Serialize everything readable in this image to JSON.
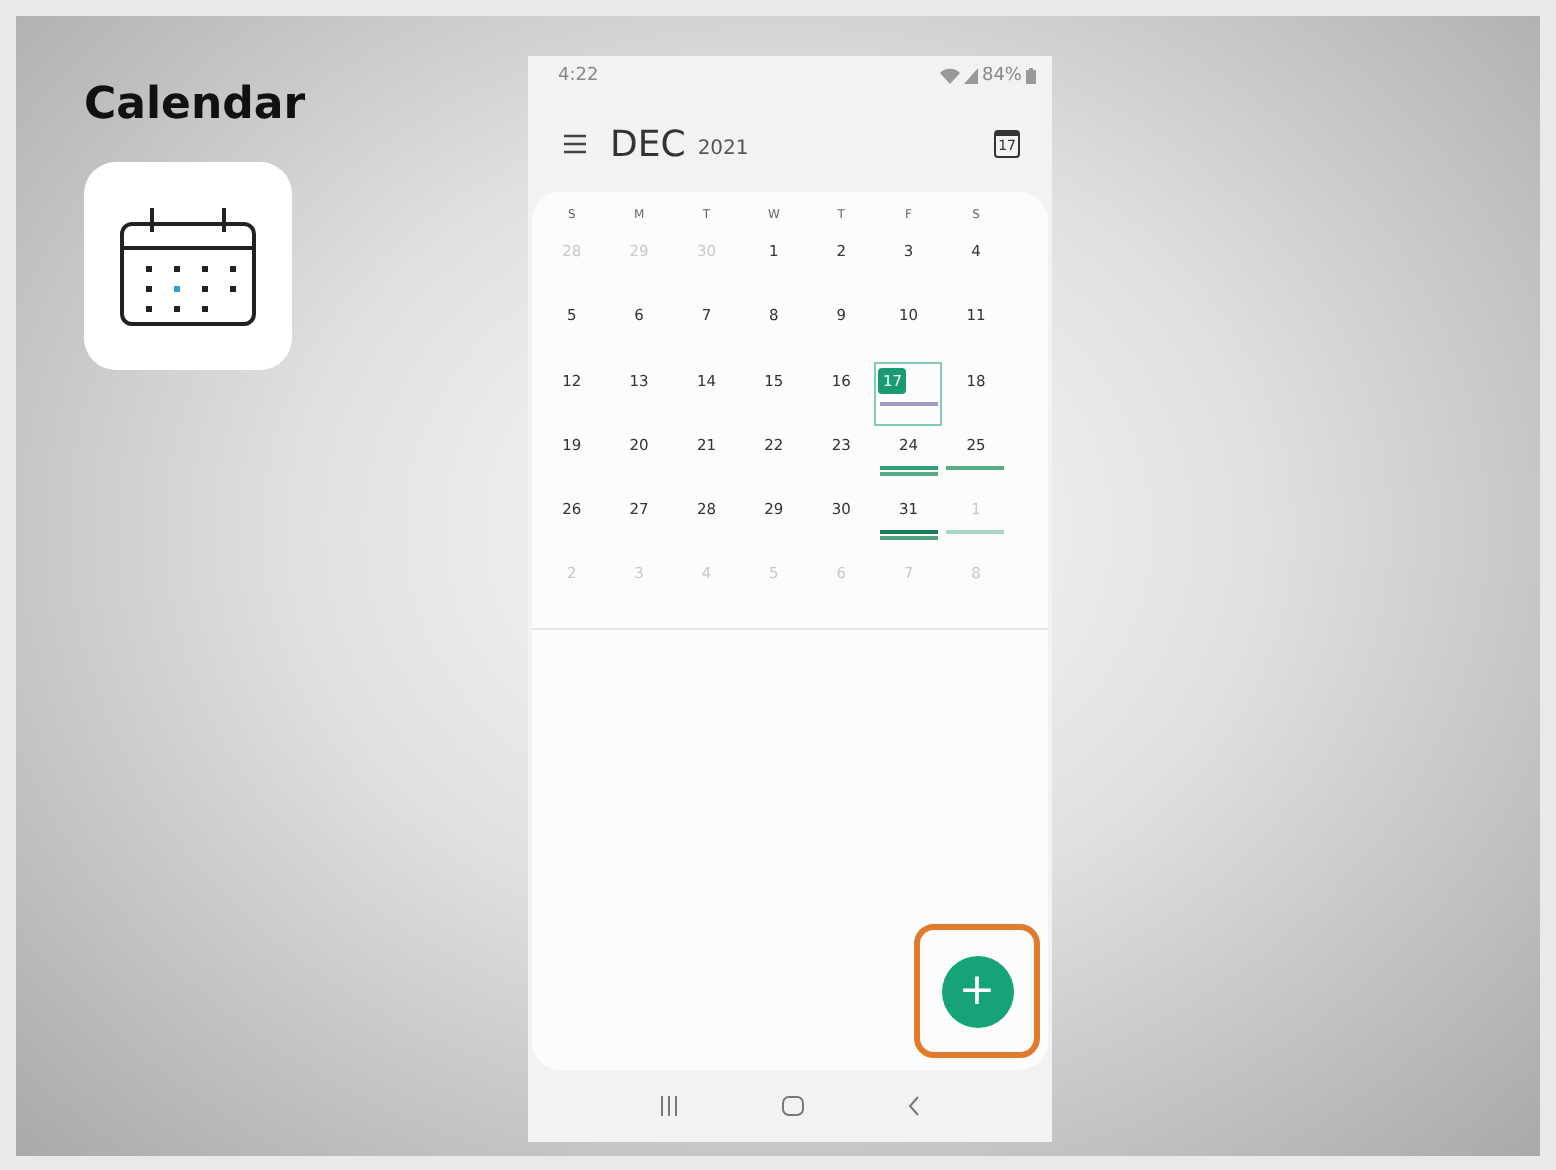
{
  "slide": {
    "title": "Calendar"
  },
  "status_bar": {
    "time": "4:22",
    "battery": "84%"
  },
  "header": {
    "month": "DEC",
    "year": "2021",
    "today_button": "17"
  },
  "weekdays": [
    "S",
    "M",
    "T",
    "W",
    "T",
    "F",
    "S"
  ],
  "weeks": [
    [
      {
        "label": "28",
        "muted": true,
        "today": false,
        "selected": false
      },
      {
        "label": "29",
        "muted": true,
        "today": false,
        "selected": false
      },
      {
        "label": "30",
        "muted": true,
        "today": false,
        "selected": false
      },
      {
        "label": "1",
        "muted": false,
        "today": false,
        "selected": false
      },
      {
        "label": "2",
        "muted": false,
        "today": false,
        "selected": false
      },
      {
        "label": "3",
        "muted": false,
        "today": false,
        "selected": false
      },
      {
        "label": "4",
        "muted": false,
        "today": false,
        "selected": false
      }
    ],
    [
      {
        "label": "5",
        "muted": false,
        "today": false,
        "selected": false
      },
      {
        "label": "6",
        "muted": false,
        "today": false,
        "selected": false
      },
      {
        "label": "7",
        "muted": false,
        "today": false,
        "selected": false
      },
      {
        "label": "8",
        "muted": false,
        "today": false,
        "selected": false
      },
      {
        "label": "9",
        "muted": false,
        "today": false,
        "selected": false
      },
      {
        "label": "10",
        "muted": false,
        "today": false,
        "selected": false
      },
      {
        "label": "11",
        "muted": false,
        "today": false,
        "selected": false
      }
    ],
    [
      {
        "label": "12",
        "muted": false,
        "today": false,
        "selected": false
      },
      {
        "label": "13",
        "muted": false,
        "today": false,
        "selected": false
      },
      {
        "label": "14",
        "muted": false,
        "today": false,
        "selected": false
      },
      {
        "label": "15",
        "muted": false,
        "today": false,
        "selected": false
      },
      {
        "label": "16",
        "muted": false,
        "today": false,
        "selected": false
      },
      {
        "label": "17",
        "muted": false,
        "today": true,
        "selected": true,
        "events": [
          {
            "color": "#a29cc4"
          }
        ]
      },
      {
        "label": "18",
        "muted": false,
        "today": false,
        "selected": false
      }
    ],
    [
      {
        "label": "19",
        "muted": false,
        "today": false,
        "selected": false
      },
      {
        "label": "20",
        "muted": false,
        "today": false,
        "selected": false
      },
      {
        "label": "21",
        "muted": false,
        "today": false,
        "selected": false
      },
      {
        "label": "22",
        "muted": false,
        "today": false,
        "selected": false
      },
      {
        "label": "23",
        "muted": false,
        "today": false,
        "selected": false
      },
      {
        "label": "24",
        "muted": false,
        "today": false,
        "selected": false,
        "events": [
          {
            "color": "#2e9e78"
          },
          {
            "color": "#5aab85"
          }
        ]
      },
      {
        "label": "25",
        "muted": false,
        "today": false,
        "selected": false,
        "events": [
          {
            "color": "#5aab85"
          }
        ]
      }
    ],
    [
      {
        "label": "26",
        "muted": false,
        "today": false,
        "selected": false
      },
      {
        "label": "27",
        "muted": false,
        "today": false,
        "selected": false
      },
      {
        "label": "28",
        "muted": false,
        "today": false,
        "selected": false
      },
      {
        "label": "29",
        "muted": false,
        "today": false,
        "selected": false
      },
      {
        "label": "30",
        "muted": false,
        "today": false,
        "selected": false
      },
      {
        "label": "31",
        "muted": false,
        "today": false,
        "selected": false,
        "events": [
          {
            "color": "#1f7a55"
          },
          {
            "color": "#4fa07c"
          }
        ]
      },
      {
        "label": "1",
        "muted": true,
        "today": false,
        "selected": false,
        "events": [
          {
            "color": "#a8d8c4"
          }
        ]
      }
    ],
    [
      {
        "label": "2",
        "muted": true,
        "today": false,
        "selected": false
      },
      {
        "label": "3",
        "muted": true,
        "today": false,
        "selected": false
      },
      {
        "label": "4",
        "muted": true,
        "today": false,
        "selected": false
      },
      {
        "label": "5",
        "muted": true,
        "today": false,
        "selected": false
      },
      {
        "label": "6",
        "muted": true,
        "today": false,
        "selected": false
      },
      {
        "label": "7",
        "muted": true,
        "today": false,
        "selected": false
      },
      {
        "label": "8",
        "muted": true,
        "today": false,
        "selected": false
      }
    ]
  ],
  "fab": {
    "label": "+",
    "highlighted": true
  }
}
